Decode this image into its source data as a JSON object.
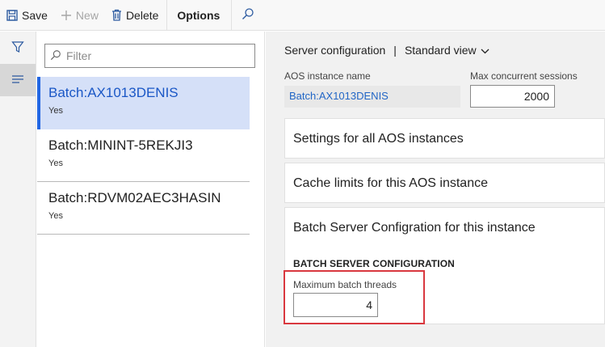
{
  "toolbar": {
    "save_label": "Save",
    "new_label": "New",
    "delete_label": "Delete",
    "options_label": "Options"
  },
  "filter": {
    "placeholder": "Filter"
  },
  "list": {
    "items": [
      {
        "title": "Batch:AX1013DENIS",
        "sub": "Yes"
      },
      {
        "title": "Batch:MININT-5REKJI3",
        "sub": "Yes"
      },
      {
        "title": "Batch:RDVM02AEC3HASIN",
        "sub": "Yes"
      }
    ]
  },
  "header": {
    "title": "Server configuration",
    "separator": "|",
    "view": "Standard view"
  },
  "fields": {
    "aos_label": "AOS instance name",
    "aos_value": "Batch:AX1013DENIS",
    "max_sessions_label": "Max concurrent sessions",
    "max_sessions_value": "2000"
  },
  "sections": {
    "settings_all": "Settings for all AOS instances",
    "cache_limits": "Cache limits for this AOS instance",
    "batch_config": "Batch Server Configration for this instance"
  },
  "batch": {
    "group_title": "BATCH SERVER CONFIGURATION",
    "threads_label": "Maximum batch threads",
    "threads_value": "4"
  },
  "colors": {
    "accent": "#2266e3",
    "selected_bg": "#d5e0f8",
    "highlight": "#d9383f"
  },
  "icons": [
    "save-icon",
    "plus-icon",
    "trash-icon",
    "search-icon",
    "funnel-icon",
    "list-icon",
    "chevron-down-icon"
  ]
}
